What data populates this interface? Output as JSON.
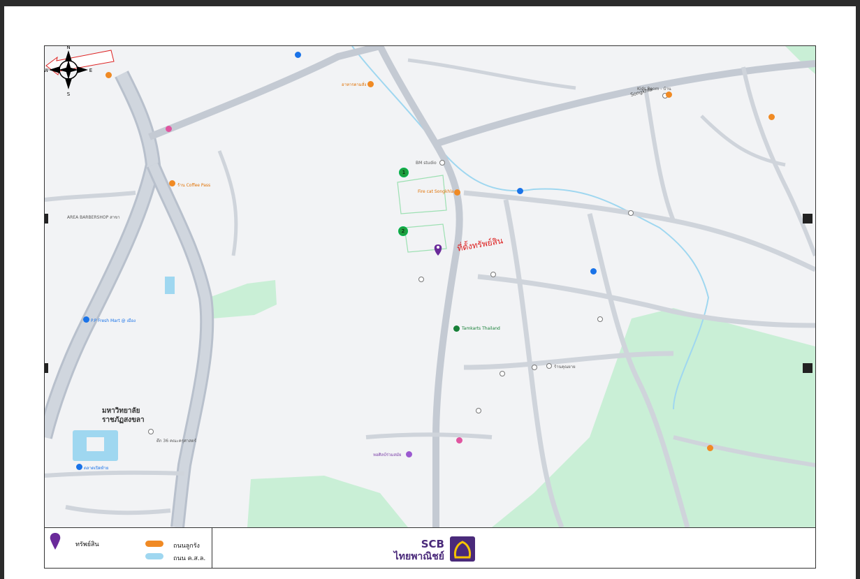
{
  "callout": {
    "label": "ที่ตั้งทรัพย์สิน"
  },
  "compass": {
    "n": "N",
    "s": "S",
    "e": "E",
    "w": "W"
  },
  "legend": {
    "asset": "ทรัพย์สิน",
    "road_orange": "ถนนลูกรัง",
    "road_blue": "ถนน ค.ส.ล."
  },
  "brand": {
    "name_en": "SCB",
    "name_th": "ไทยพาณิชย์"
  },
  "markers": {
    "m1": "1",
    "m2": "2"
  },
  "colors": {
    "poi_orange": "#f08a24",
    "poi_blue": "#1a73e8",
    "park": "#c9efd6",
    "water": "#9fd7f0",
    "brand": "#4a2a7a",
    "callout": "#dd2222"
  },
  "places": {
    "coffee": "ร้าน Coffee Pass",
    "fire_cat": "Fire cat Songkhla",
    "bm_studio": "BM studio",
    "area_barbershop": "AREA BARBERSHOP สาขา",
    "pp_fresh": "P.P Fresh Mart @ เมือง",
    "university": "มหาวิทยาลัย",
    "university2": "ราชภัฏสงขลา",
    "minimart": "Tamkarts Thailand",
    "kids_room": "Kids Room - บ้าน",
    "songkhla_road": "Songkhla",
    "ramkhamhaeng": "ร้านคุณยาย",
    "skru": "ตึก 36 คณะครุศาสตร์",
    "market": "ตลาดเปิดท้าย",
    "art_gallery": "หอศิลป์ร่วมสมัย",
    "ahan": "อาหารตามสั่ง"
  }
}
